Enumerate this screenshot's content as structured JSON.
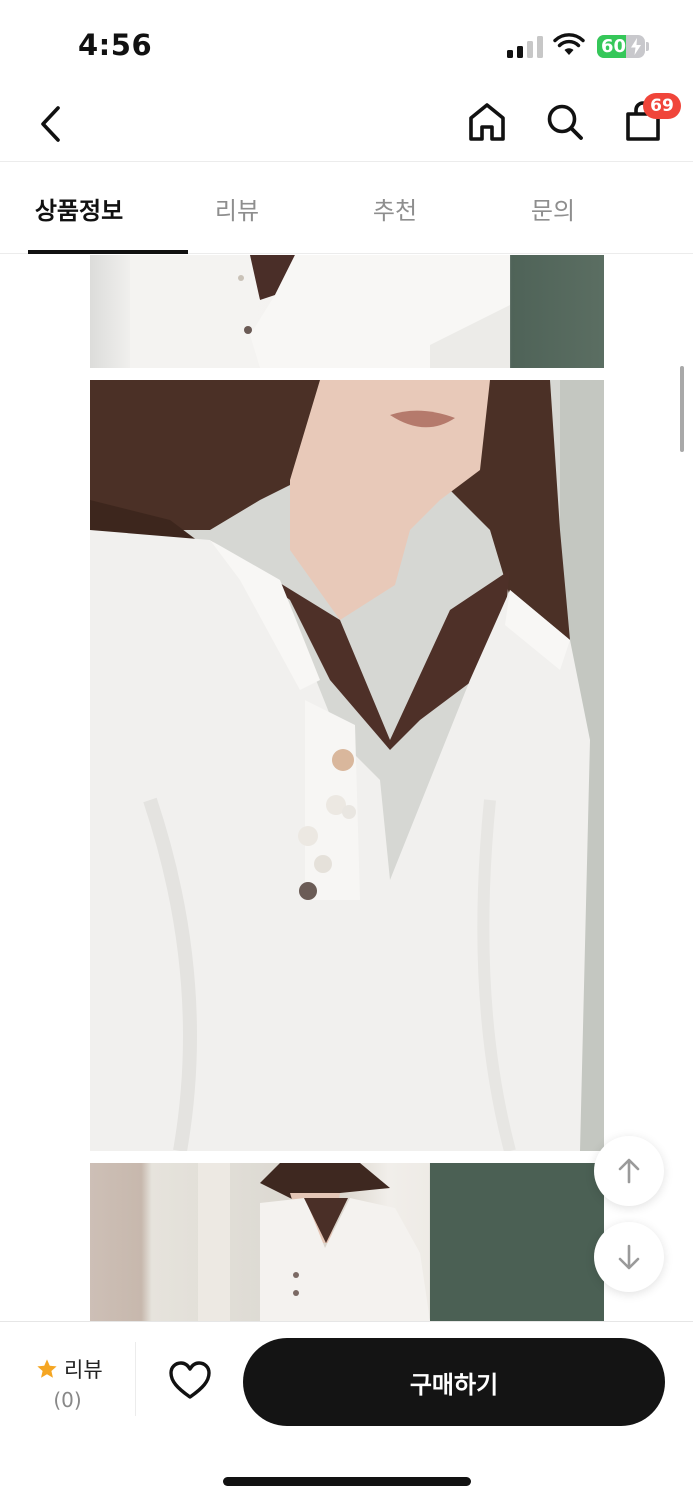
{
  "status_bar": {
    "time": "4:56",
    "battery": "60",
    "battery_level": 0.6
  },
  "header": {
    "back_icon": "chevron-left-icon",
    "home_icon": "home-icon",
    "search_icon": "search-icon",
    "cart_icon": "shopping-bag-icon",
    "cart_badge": "69",
    "badge_color": "#f0453a"
  },
  "tabs": [
    {
      "label": "상품정보",
      "active": true
    },
    {
      "label": "리뷰",
      "active": false
    },
    {
      "label": "추천",
      "active": false
    },
    {
      "label": "문의",
      "active": false
    }
  ],
  "content": {
    "photos": [
      "product-photo-1",
      "product-photo-2",
      "product-photo-3"
    ]
  },
  "floating": {
    "up_icon": "arrow-up-icon",
    "down_icon": "arrow-down-icon"
  },
  "bottom_bar": {
    "review_label": "리뷰",
    "review_count": "(0)",
    "star_color": "#f5a623",
    "wish_icon": "heart-icon",
    "buy_label": "구매하기"
  }
}
